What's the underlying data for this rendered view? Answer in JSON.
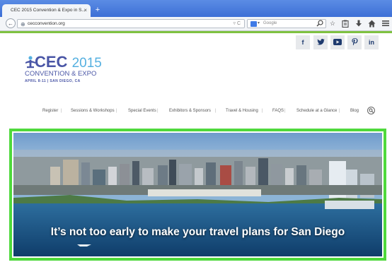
{
  "browser": {
    "tab_title": "CEC 2015 Convention & Expo in S...",
    "tab_close": "×",
    "new_tab": "+",
    "back": "←",
    "url": "cecconvention.org",
    "url_icons": "▿ C",
    "search_placeholder": "Google",
    "search_engine_caret": "▾",
    "toolbar_icons": [
      "search-icon",
      "star-icon",
      "clipboard-icon",
      "download-icon",
      "home-icon",
      "menu-icon"
    ]
  },
  "social": [
    {
      "name": "facebook",
      "glyph": "f"
    },
    {
      "name": "twitter",
      "glyph": "t"
    },
    {
      "name": "youtube",
      "glyph": "▶"
    },
    {
      "name": "pinterest",
      "glyph": "P"
    },
    {
      "name": "linkedin",
      "glyph": "in"
    }
  ],
  "logo": {
    "main": "CEC",
    "year": "2015",
    "subtitle": "CONVENTION & EXPO",
    "dates": "APRIL 8-11 | SAN DIEGO, CA"
  },
  "nav": [
    "Register",
    "Sessions & Workshops",
    "Special Events",
    "Exhibitors & Sponsors",
    "Travel & Housing",
    "FAQS",
    "Schedule at a Glance",
    "Blog"
  ],
  "nav_separator": "|",
  "hero": {
    "caption": "It’s not too early to make your travel plans for San Diego"
  },
  "colors": {
    "brand": "#4a56a6",
    "brand_light": "#55b0e0",
    "highlight_frame": "#4fd93c",
    "top_rule": "#7fc241",
    "social_icon": "#1e3a6e"
  }
}
